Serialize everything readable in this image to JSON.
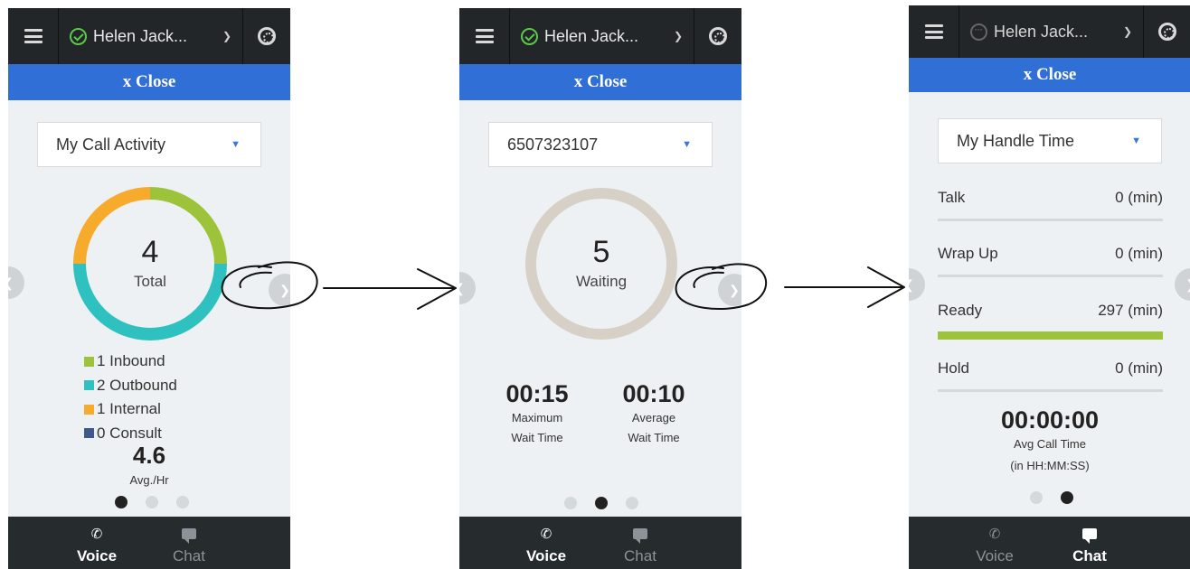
{
  "colors": {
    "topbar": "#222628",
    "close_bar": "#2f6fd6",
    "inbound": "#9dc33a",
    "outbound": "#2ec1c0",
    "internal": "#f6ab2d",
    "consult": "#3d5a8a",
    "waiting_ring": "#d6d0c6",
    "ready_bar": "#9dc33a"
  },
  "panel1": {
    "user_name": "Helen Jack...",
    "close_label": "x Close",
    "dropdown_value": "My Call Activity",
    "total_value": "4",
    "total_label": "Total",
    "legend": [
      {
        "label": "1 Inbound",
        "count": 1,
        "color": "#9dc33a"
      },
      {
        "label": "2 Outbound",
        "count": 2,
        "color": "#2ec1c0"
      },
      {
        "label": "1 Internal",
        "count": 1,
        "color": "#f6ab2d"
      },
      {
        "label": "0 Consult",
        "count": 0,
        "color": "#3d5a8a"
      }
    ],
    "avg_value": "4.6",
    "avg_label": "Avg./Hr",
    "active_dot": 1,
    "tabs": {
      "voice": "Voice",
      "chat": "Chat",
      "active": "voice"
    }
  },
  "panel2": {
    "user_name": "Helen Jack...",
    "close_label": "x Close",
    "dropdown_value": "6507323107",
    "waiting_value": "5",
    "waiting_label": "Waiting",
    "max_wait": {
      "value": "00:15",
      "line1": "Maximum",
      "line2": "Wait Time"
    },
    "avg_wait": {
      "value": "00:10",
      "line1": "Average",
      "line2": "Wait Time"
    },
    "active_dot": 2,
    "tabs": {
      "voice": "Voice",
      "chat": "Chat",
      "active": "voice"
    }
  },
  "panel3": {
    "user_name": "Helen Jack...",
    "close_label": "x Close",
    "dropdown_value": "My Handle Time",
    "metrics": [
      {
        "name": "Talk",
        "value": "0 (min)"
      },
      {
        "name": "Wrap Up",
        "value": "0 (min)"
      },
      {
        "name": "Ready",
        "value": "297 (min)"
      },
      {
        "name": "Hold",
        "value": "0 (min)"
      }
    ],
    "handle_value": "00:00:00",
    "handle_label1": "Avg Call Time",
    "handle_label2": "(in HH:MM:SS)",
    "active_dot": 2,
    "tabs": {
      "voice": "Voice",
      "chat": "Chat",
      "active": "chat"
    }
  },
  "icons": {
    "menu": "hamburger-icon",
    "status_ready": "check-circle-icon",
    "status_away": "ellipsis-circle-icon",
    "chevron": "chevron-down-icon",
    "help": "lifebuoy-icon",
    "prev": "chevron-left-icon",
    "next": "chevron-right-icon",
    "voice": "phone-icon",
    "chat": "chat-bubble-icon"
  }
}
